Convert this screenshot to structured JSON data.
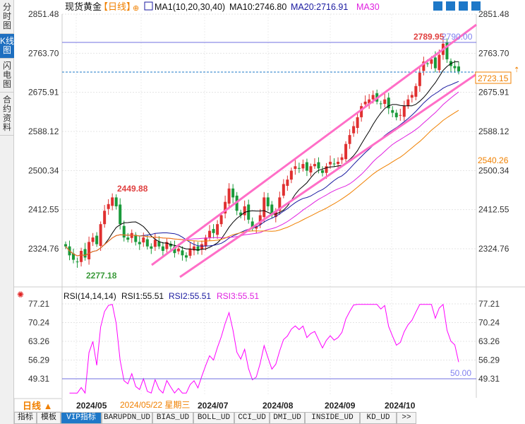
{
  "sidebar": {
    "tabs": [
      "分时图",
      "K线图",
      "闪电图",
      "合约资料"
    ],
    "active": 1
  },
  "header": {
    "symbol": "现货黄金",
    "period": "【日线】",
    "ma_label": "MA1(10,20,30,40)",
    "ma10": "MA10:2746.80",
    "ma20": "MA20:2716.91",
    "ma30": "MA30"
  },
  "price_labels": {
    "high": "2789.95",
    "line": "2790.00",
    "high_low_left": "2449.88",
    "low": "2277.18",
    "current": "2723.15",
    "ma_tag": "2540.26",
    "rsi_ref": "50.00"
  },
  "rsi_header": {
    "name": "RSI(14,14,14)",
    "rsi1": "RSI1:55.51",
    "rsi2": "RSI2:55.51",
    "rsi3": "RSI3:55.51"
  },
  "bottom": {
    "period_button": "日线 ▲",
    "crosshair_date": "2024/05/22 星期三"
  },
  "tabs": [
    "指标",
    "模板",
    "VIP指标",
    "BARUPDN_UD",
    "BIAS_UD",
    "BOLL_UD",
    "CCI_UD",
    "DMI_UD",
    "INSIDE_UD",
    "KD_UD",
    ">>"
  ],
  "colors": {
    "up": "#e03030",
    "down": "#1a9a3a",
    "ma10": "#000000",
    "ma20": "#1a1aa0",
    "ma30": "#e020e0",
    "ma40": "#f08000",
    "channel": "#ff6ec7",
    "accent": "#1e6fc0"
  },
  "chart_data": [
    {
      "type": "candlestick",
      "title": "现货黄金 日线",
      "y_ticks": [
        "2851.48",
        "2763.70",
        "2675.91",
        "2588.12",
        "2500.34",
        "2412.55",
        "2324.76"
      ],
      "ylim": [
        2324.76,
        2851.48
      ],
      "x_ticks": [
        "2024/05",
        "2024/07",
        "2024/08",
        "2024/09",
        "2024/10"
      ],
      "closes": [
        2330,
        2310,
        2300,
        2295,
        2320,
        2305,
        2340,
        2350,
        2335,
        2380,
        2410,
        2425,
        2440,
        2420,
        2380,
        2350,
        2345,
        2360,
        2340,
        2335,
        2350,
        2330,
        2325,
        2345,
        2330,
        2320,
        2340,
        2330,
        2315,
        2325,
        2310,
        2305,
        2325,
        2330,
        2320,
        2335,
        2350,
        2365,
        2360,
        2380,
        2400,
        2430,
        2460,
        2440,
        2410,
        2400,
        2420,
        2390,
        2370,
        2375,
        2400,
        2440,
        2420,
        2400,
        2410,
        2440,
        2470,
        2480,
        2500,
        2510,
        2505,
        2515,
        2500,
        2510,
        2515,
        2505,
        2495,
        2510,
        2520,
        2515,
        2520,
        2530,
        2560,
        2580,
        2600,
        2620,
        2645,
        2655,
        2660,
        2670,
        2655,
        2650,
        2660,
        2640,
        2630,
        2620,
        2625,
        2645,
        2660,
        2670,
        2690,
        2720,
        2745,
        2740,
        2750,
        2730,
        2760,
        2785,
        2750,
        2735,
        2730,
        2723.15
      ]
    },
    {
      "type": "line",
      "title": "RSI(14,14,14)",
      "y_ticks": [
        "77.21",
        "70.24",
        "63.26",
        "56.29",
        "49.31"
      ],
      "ylim": [
        49.31,
        77.21
      ],
      "last": 55.51
    }
  ]
}
